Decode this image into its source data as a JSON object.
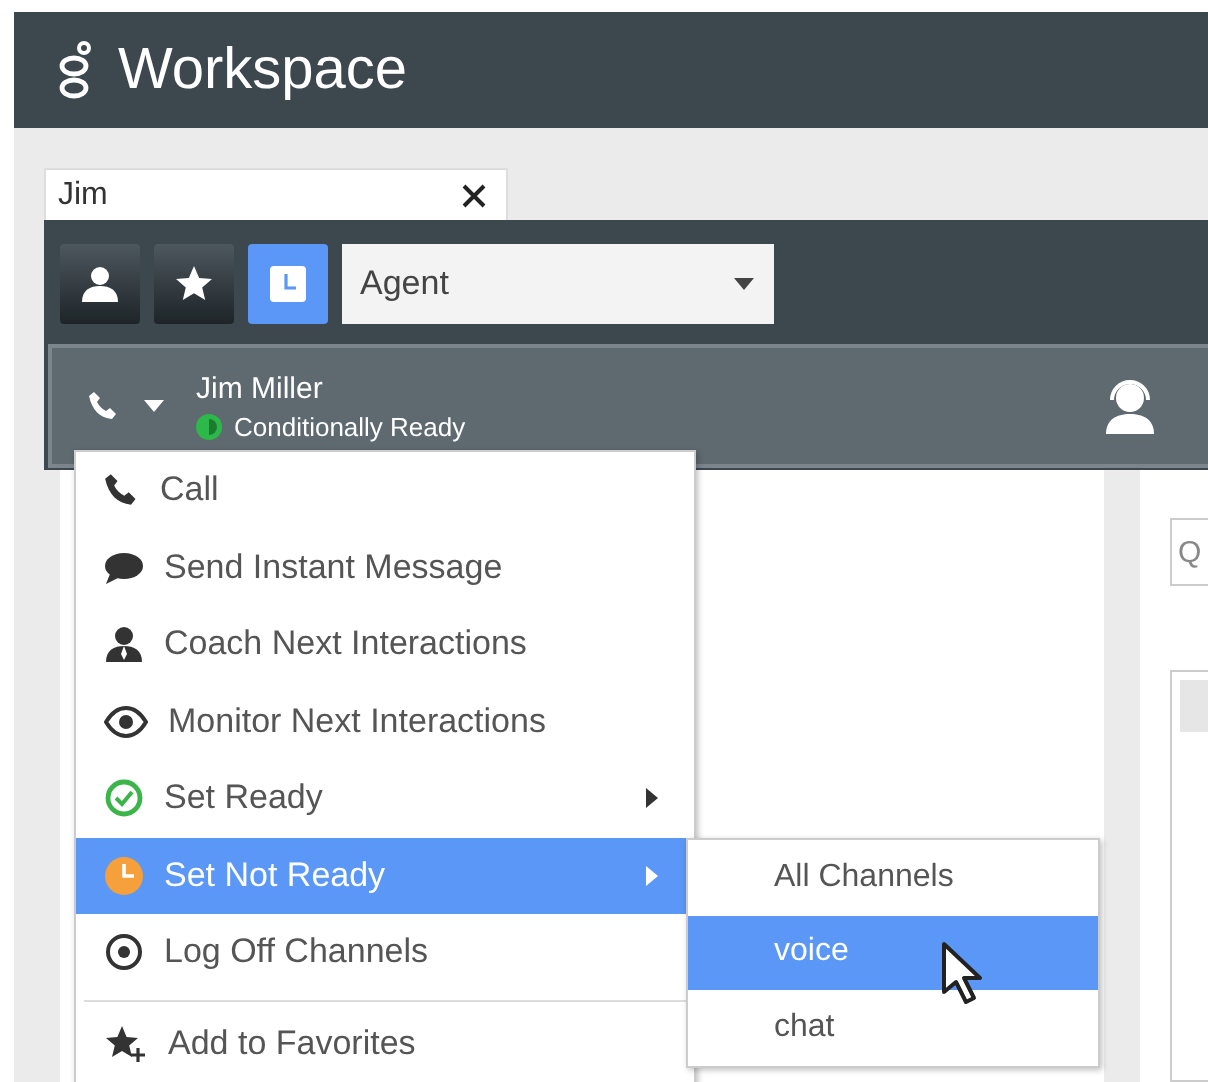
{
  "app": {
    "title": "Workspace"
  },
  "search": {
    "value": "Jim"
  },
  "toolbar": {
    "buttons": [
      {
        "kind": "person",
        "selected": false
      },
      {
        "kind": "star",
        "selected": false
      },
      {
        "kind": "recent",
        "selected": true
      }
    ],
    "filter": {
      "value": "Agent"
    }
  },
  "agent": {
    "name": "Jim Miller",
    "status": "Conditionally Ready"
  },
  "right_panel": {
    "field_text": "Q"
  },
  "menu": {
    "items": [
      {
        "kind": "call",
        "label": "Call",
        "selected": false,
        "submenu": false
      },
      {
        "kind": "message",
        "label": "Send Instant Message",
        "selected": false,
        "submenu": false
      },
      {
        "kind": "coach",
        "label": "Coach Next Interactions",
        "selected": false,
        "submenu": false
      },
      {
        "kind": "monitor",
        "label": "Monitor Next Interactions",
        "selected": false,
        "submenu": false
      },
      {
        "kind": "ready",
        "label": "Set Ready",
        "selected": false,
        "submenu": true
      },
      {
        "kind": "not_ready",
        "label": "Set Not Ready",
        "selected": true,
        "submenu": true
      },
      {
        "kind": "log_off",
        "label": "Log Off Channels",
        "selected": false,
        "submenu": false
      },
      {
        "kind": "favorite",
        "label": "Add to Favorites",
        "selected": false,
        "submenu": false
      }
    ]
  },
  "submenu": {
    "items": [
      {
        "label": "All Channels",
        "selected": false
      },
      {
        "label": "voice",
        "selected": true
      },
      {
        "label": "chat",
        "selected": false
      }
    ]
  }
}
